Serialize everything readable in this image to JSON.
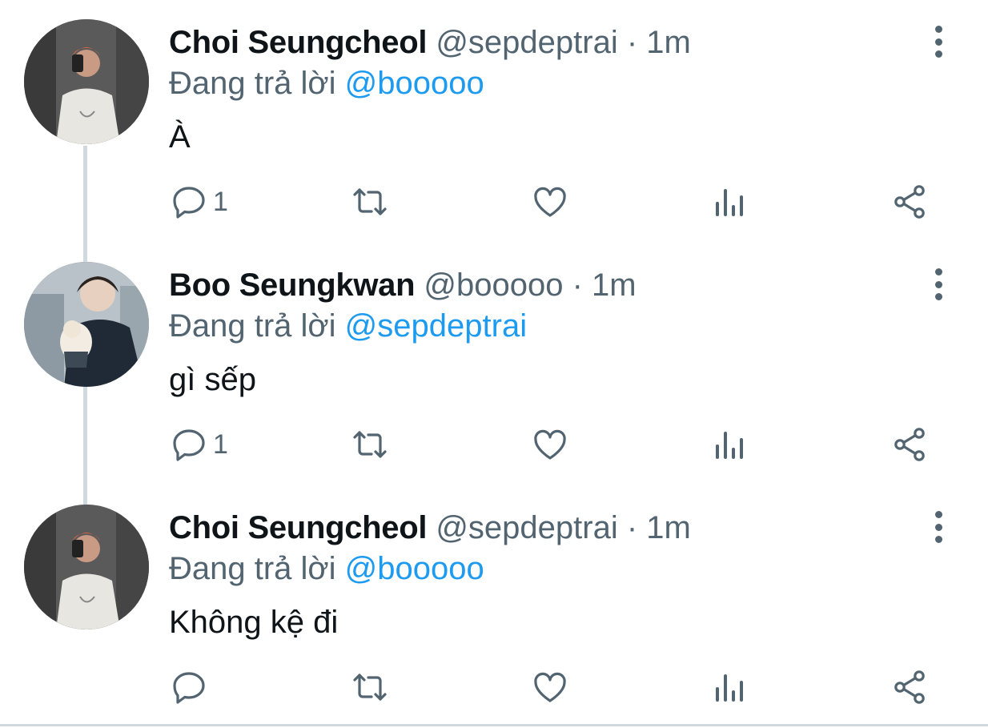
{
  "tweets": [
    {
      "name": "Choi Seungcheol",
      "handle": "@sepdeptrai",
      "time": "· 1m",
      "reply_prefix": "Đang trả lời",
      "reply_to": "@booooo",
      "text": "À",
      "reply_count": "1",
      "avatar": "selfie-avatar"
    },
    {
      "name": "Boo Seungkwan",
      "handle": "@booooo",
      "time": "· 1m",
      "reply_prefix": "Đang trả lời",
      "reply_to": "@sepdeptrai",
      "text": "gì sếp",
      "reply_count": "1",
      "avatar": "cat-avatar"
    },
    {
      "name": "Choi Seungcheol",
      "handle": "@sepdeptrai",
      "time": "· 1m",
      "reply_prefix": "Đang trả lời",
      "reply_to": "@booooo",
      "text": "Không kệ đi",
      "reply_count": "",
      "avatar": "selfie-avatar"
    }
  ],
  "icons": {
    "reply": "reply-icon",
    "retweet": "retweet-icon",
    "like": "heart-icon",
    "analytics": "analytics-icon",
    "share": "share-icon",
    "more": "more-vertical-icon"
  },
  "colors": {
    "text": "#0f1419",
    "secondary": "#536471",
    "link": "#1d9bf0",
    "thread_line": "#cfd9de"
  }
}
